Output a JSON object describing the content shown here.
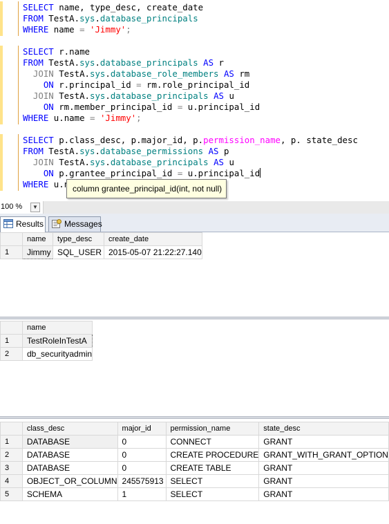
{
  "editor": {
    "lines": [
      [
        {
          "t": "SELECT",
          "c": "kw"
        },
        {
          "t": " name, type_desc, create_date",
          "c": ""
        }
      ],
      [
        {
          "t": "FROM",
          "c": "kw"
        },
        {
          "t": " TestA.",
          "c": ""
        },
        {
          "t": "sys",
          "c": "obj"
        },
        {
          "t": ".",
          "c": ""
        },
        {
          "t": "database_principals",
          "c": "obj"
        }
      ],
      [
        {
          "t": "WHERE",
          "c": "kw"
        },
        {
          "t": " name ",
          "c": ""
        },
        {
          "t": "=",
          "c": "gr"
        },
        {
          "t": " ",
          "c": ""
        },
        {
          "t": "'Jimmy'",
          "c": "str"
        },
        {
          "t": ";",
          "c": "gr"
        }
      ],
      [],
      [
        {
          "t": "SELECT",
          "c": "kw"
        },
        {
          "t": " r.name",
          "c": ""
        }
      ],
      [
        {
          "t": "FROM",
          "c": "kw"
        },
        {
          "t": " TestA.",
          "c": ""
        },
        {
          "t": "sys",
          "c": "obj"
        },
        {
          "t": ".",
          "c": ""
        },
        {
          "t": "database_principals",
          "c": "obj"
        },
        {
          "t": " ",
          "c": ""
        },
        {
          "t": "AS",
          "c": "kw"
        },
        {
          "t": " r",
          "c": ""
        }
      ],
      [
        {
          "t": "  ",
          "c": ""
        },
        {
          "t": "JOIN",
          "c": "gr"
        },
        {
          "t": " TestA.",
          "c": ""
        },
        {
          "t": "sys",
          "c": "obj"
        },
        {
          "t": ".",
          "c": ""
        },
        {
          "t": "database_role_members",
          "c": "obj"
        },
        {
          "t": " ",
          "c": ""
        },
        {
          "t": "AS",
          "c": "kw"
        },
        {
          "t": " rm",
          "c": ""
        }
      ],
      [
        {
          "t": "    ",
          "c": ""
        },
        {
          "t": "ON",
          "c": "kw"
        },
        {
          "t": " r.principal_id ",
          "c": ""
        },
        {
          "t": "=",
          "c": "gr"
        },
        {
          "t": " rm.role_principal_id",
          "c": ""
        }
      ],
      [
        {
          "t": "  ",
          "c": ""
        },
        {
          "t": "JOIN",
          "c": "gr"
        },
        {
          "t": " TestA.",
          "c": ""
        },
        {
          "t": "sys",
          "c": "obj"
        },
        {
          "t": ".",
          "c": ""
        },
        {
          "t": "database_principals",
          "c": "obj"
        },
        {
          "t": " ",
          "c": ""
        },
        {
          "t": "AS",
          "c": "kw"
        },
        {
          "t": " u",
          "c": ""
        }
      ],
      [
        {
          "t": "    ",
          "c": ""
        },
        {
          "t": "ON",
          "c": "kw"
        },
        {
          "t": " rm.member_principal_id ",
          "c": ""
        },
        {
          "t": "=",
          "c": "gr"
        },
        {
          "t": " u.principal_id",
          "c": ""
        }
      ],
      [
        {
          "t": "WHERE",
          "c": "kw"
        },
        {
          "t": " u.name ",
          "c": ""
        },
        {
          "t": "=",
          "c": "gr"
        },
        {
          "t": " ",
          "c": ""
        },
        {
          "t": "'Jimmy'",
          "c": "str"
        },
        {
          "t": ";",
          "c": "gr"
        }
      ],
      [],
      [
        {
          "t": "SELECT",
          "c": "kw"
        },
        {
          "t": " p.class_desc, p.major_id, p.",
          "c": ""
        },
        {
          "t": "permission_name",
          "c": "fn"
        },
        {
          "t": ", p. state_desc",
          "c": ""
        }
      ],
      [
        {
          "t": "FROM",
          "c": "kw"
        },
        {
          "t": " TestA.",
          "c": ""
        },
        {
          "t": "sys",
          "c": "obj"
        },
        {
          "t": ".",
          "c": ""
        },
        {
          "t": "database_permissions",
          "c": "obj"
        },
        {
          "t": " ",
          "c": ""
        },
        {
          "t": "AS",
          "c": "kw"
        },
        {
          "t": " p",
          "c": ""
        }
      ],
      [
        {
          "t": "  ",
          "c": ""
        },
        {
          "t": "JOIN",
          "c": "gr"
        },
        {
          "t": " TestA.",
          "c": ""
        },
        {
          "t": "sys",
          "c": "obj"
        },
        {
          "t": ".",
          "c": ""
        },
        {
          "t": "database_principals",
          "c": "obj"
        },
        {
          "t": " ",
          "c": ""
        },
        {
          "t": "AS",
          "c": "kw"
        },
        {
          "t": " u",
          "c": ""
        }
      ],
      [
        {
          "t": "    ",
          "c": ""
        },
        {
          "t": "ON",
          "c": "kw"
        },
        {
          "t": " p.grantee_principal_id ",
          "c": ""
        },
        {
          "t": "=",
          "c": "gr"
        },
        {
          "t": " u.principal_id",
          "c": ""
        },
        {
          "t": "|caret|",
          "c": "caret"
        }
      ],
      [
        {
          "t": "WHERE",
          "c": "kw"
        },
        {
          "t": " u.n",
          "c": ""
        }
      ]
    ],
    "tooltip": "column grantee_principal_id(int, not null)",
    "colors": {
      "keyword": "#0000ff",
      "object": "#008080",
      "string": "#ff0000",
      "function": "#ff00ff",
      "operator": "#808080"
    }
  },
  "zoom": {
    "value": "100 %"
  },
  "tabs": [
    {
      "label": "Results",
      "icon": "grid-icon",
      "active": true
    },
    {
      "label": "Messages",
      "icon": "messages-icon",
      "active": false
    }
  ],
  "results": [
    {
      "columns": [
        "name",
        "type_desc",
        "create_date"
      ],
      "rows": [
        [
          "1",
          "Jimmy",
          "SQL_USER",
          "2015-05-07 21:22:27.140"
        ]
      ]
    },
    {
      "columns": [
        "name"
      ],
      "rows": [
        [
          "1",
          "TestRoleInTestA"
        ],
        [
          "2",
          "db_securityadmin"
        ]
      ]
    },
    {
      "columns": [
        "class_desc",
        "major_id",
        "permission_name",
        "state_desc"
      ],
      "rows": [
        [
          "1",
          "DATABASE",
          "0",
          "CONNECT",
          "GRANT"
        ],
        [
          "2",
          "DATABASE",
          "0",
          "CREATE PROCEDURE",
          "GRANT_WITH_GRANT_OPTION"
        ],
        [
          "3",
          "DATABASE",
          "0",
          "CREATE TABLE",
          "GRANT"
        ],
        [
          "4",
          "OBJECT_OR_COLUMN",
          "245575913",
          "SELECT",
          "GRANT"
        ],
        [
          "5",
          "SCHEMA",
          "1",
          "SELECT",
          "GRANT"
        ]
      ]
    }
  ]
}
